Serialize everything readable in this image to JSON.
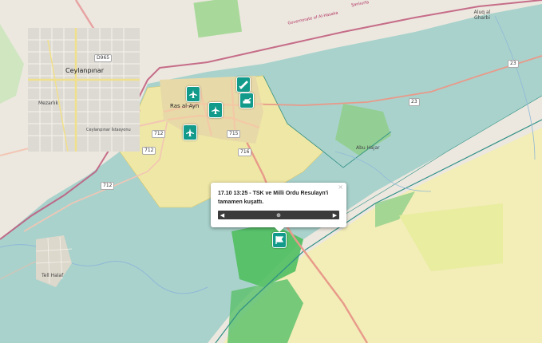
{
  "map": {
    "colors": {
      "base": "#e9e5dc",
      "kurdish_zone": "#a9d2cc",
      "syrian_zone": "#f3edb7",
      "turkish_zone": "#f6e9a3",
      "green_area": "#8fcf8a",
      "border_line": "#c0577a",
      "marker": "#129a8a"
    },
    "labels": {
      "ceylanpinar": "Ceylanpınar",
      "resulayn": "Ras al-Ayn",
      "abu_hajar": "Abu Hajar",
      "aluq": "Aluq al Gharbi",
      "tell_halaf": "Tell Halaf",
      "mezarlik": "Mezarlık",
      "ceylanpinar_istasyon": "Ceylanpınar İstasyonu"
    },
    "border_labels": [
      "Governorate of Al-Hasaka",
      "Şanlıurfa"
    ],
    "road_refs": [
      "D965",
      "712",
      "712",
      "712",
      "715",
      "716",
      "23",
      "23"
    ],
    "markers": [
      {
        "icon": "jet-icon"
      },
      {
        "icon": "jet-icon"
      },
      {
        "icon": "jet-icon"
      },
      {
        "icon": "artillery-icon"
      },
      {
        "icon": "tank-icon"
      },
      {
        "icon": "flag-icon"
      }
    ]
  },
  "popup": {
    "text": "17.10 13:25 - TSK ve Milli Ordu Resulayn'i tamamen kuşattı.",
    "close": "×",
    "prev": "◀",
    "add": "⊕",
    "next": "▶"
  }
}
